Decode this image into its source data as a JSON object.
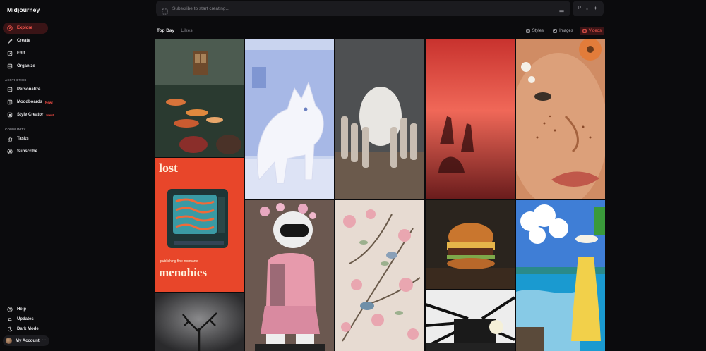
{
  "app": {
    "title": "Midjourney"
  },
  "nav": {
    "items": [
      {
        "label": "Explore",
        "icon": "compass-icon",
        "active": true
      },
      {
        "label": "Create",
        "icon": "brush-icon"
      },
      {
        "label": "Edit",
        "icon": "edit-icon"
      },
      {
        "label": "Organize",
        "icon": "folder-icon"
      }
    ],
    "aesthetics_label": "AESTHETICS",
    "aesthetics": [
      {
        "label": "Personalize",
        "icon": "personalize-icon"
      },
      {
        "label": "Moodboards",
        "icon": "moodboard-icon",
        "badge": "New!"
      },
      {
        "label": "Style Creator",
        "icon": "style-creator-icon",
        "badge": "New!"
      }
    ],
    "community_label": "COMMUNITY",
    "community": [
      {
        "label": "Tasks",
        "icon": "thumb-icon"
      },
      {
        "label": "Subscribe",
        "icon": "user-icon"
      }
    ],
    "bottom": [
      {
        "label": "Help",
        "icon": "help-icon"
      },
      {
        "label": "Updates",
        "icon": "bell-icon"
      },
      {
        "label": "Dark Mode",
        "icon": "moon-icon"
      }
    ],
    "account": {
      "label": "My Account",
      "more": "···"
    }
  },
  "search": {
    "placeholder": "Subscribe to start creating..."
  },
  "top_controls": {
    "p_label": "P",
    "chevron": "⌄"
  },
  "tabs": [
    {
      "label": "Top Day",
      "active": true
    },
    {
      "label": "Likes",
      "active": false
    }
  ],
  "filters": [
    {
      "label": "Styles",
      "icon": "styles-icon"
    },
    {
      "label": "Images",
      "icon": "image-icon"
    },
    {
      "label": "Videos",
      "icon": "video-icon",
      "active": true
    }
  ],
  "tiles": {
    "koi_room": {
      "alt": "koi pond room"
    },
    "white_cat": {
      "alt": "white fluffy cat"
    },
    "egg_rabbits": {
      "alt": "rabbits carrying egg"
    },
    "red_horses": {
      "alt": "red riders"
    },
    "freckled_face": {
      "alt": "freckled face with flowers"
    },
    "lost_poster": {
      "top_text": "lost",
      "bottom_text": "menohies",
      "small_text": "publishing fine-normane"
    },
    "robot_girl": {
      "alt": "astronaut helmet figure"
    },
    "floral_birds": {
      "alt": "floral wallpaper with birds"
    },
    "burger": {
      "alt": "burger"
    },
    "anime_beach": {
      "alt": "girl on beach"
    },
    "tree_dark": {
      "alt": "dark tree"
    },
    "train": {
      "alt": "train sketch"
    }
  },
  "colors": {
    "accent": "#ff5a50",
    "accent_bg": "#3a1416",
    "bg": "#0b0b0d",
    "panel": "#1b1b1f"
  }
}
